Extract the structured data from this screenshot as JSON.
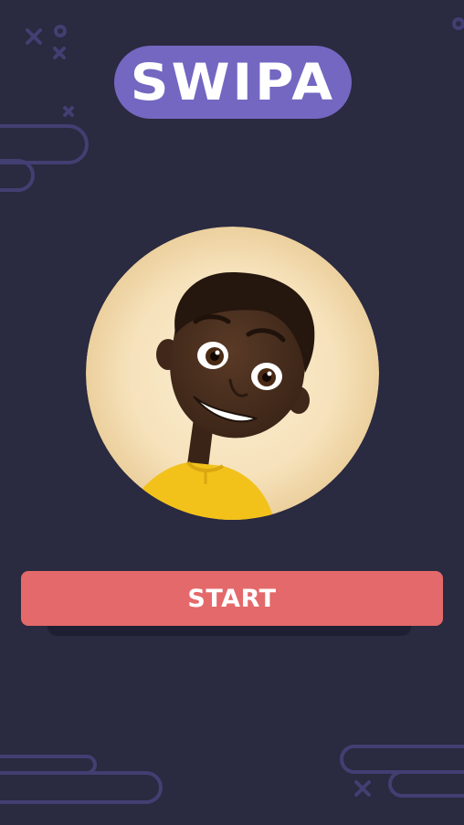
{
  "app": {
    "logo_text": "SWIPA"
  },
  "avatar": {
    "icon": "smiling-boy-avatar",
    "background_color": "#f4dfb6",
    "shirt_color": "#f2c21b"
  },
  "actions": {
    "start_label": "START"
  },
  "colors": {
    "background": "#2a2a40",
    "logo_pill": "#7367c2",
    "start_button": "#e4696a",
    "decoration_stroke": "#423f72"
  }
}
